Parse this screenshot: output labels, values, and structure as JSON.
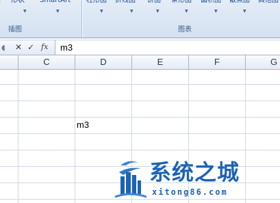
{
  "ribbon": {
    "items": [
      "形状",
      "SmartArt",
      "柱形图",
      "折线图",
      "饼图",
      "条形图",
      "面积图",
      "散点图",
      "其他图"
    ],
    "groups": {
      "illustrations": "插图",
      "charts": "图表"
    }
  },
  "formula_bar": {
    "icons": [
      "scroll-icon",
      "cancel-icon",
      "enter-icon",
      "fx-icon"
    ],
    "fx_label": "fx",
    "value": "m3"
  },
  "sheet": {
    "columns": [
      "C",
      "D",
      "E",
      "F",
      "G"
    ],
    "active_cell_text": "m3"
  },
  "watermark": {
    "title": "系统之城",
    "url": "xitong86.com"
  },
  "colors": {
    "ribbon_text": "#15428b",
    "grid_line": "#d0d7e5",
    "header_border": "#9eb6ce",
    "watermark_blue": "#1d63b5"
  }
}
